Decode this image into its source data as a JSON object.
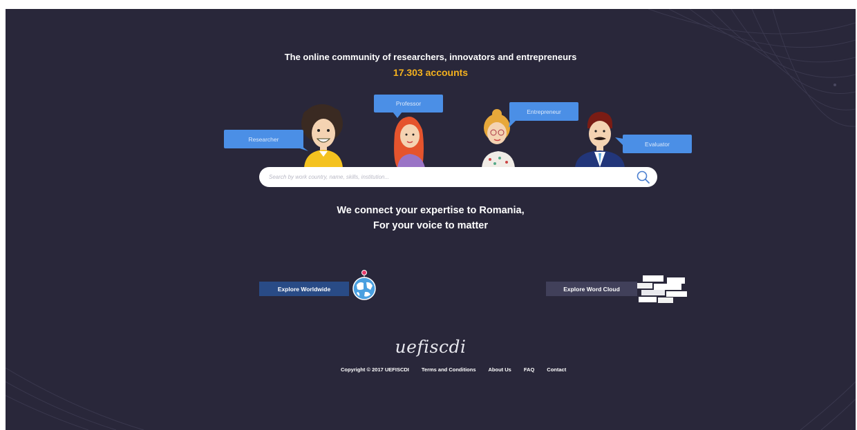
{
  "hero": {
    "tagline": "The online community of researchers, innovators and entrepreneurs",
    "accounts": "17.303 accounts"
  },
  "characters": [
    {
      "role": "Researcher"
    },
    {
      "role": "Professor"
    },
    {
      "role": "Entrepreneur"
    },
    {
      "role": "Evaluator"
    }
  ],
  "search": {
    "placeholder": "Search by work country, name, skills, institution..."
  },
  "mission": {
    "line1": "We connect your expertise to Romania,",
    "line2": "For your voice to matter"
  },
  "explore": {
    "worldwide_label": "Explore Worldwide",
    "wordcloud_label": "Explore Word Cloud"
  },
  "footer": {
    "logo": "uefiscdi",
    "copyright": "Copyright © 2017 UEFISCDI",
    "terms": "Terms and Conditions",
    "about": "About Us",
    "faq": "FAQ",
    "contact": "Contact"
  },
  "colors": {
    "background": "#29273a",
    "accent": "#f5b21e",
    "bubble": "#4b8fe6",
    "worldwide_button": "#294b86",
    "wordcloud_button": "#41405a"
  }
}
